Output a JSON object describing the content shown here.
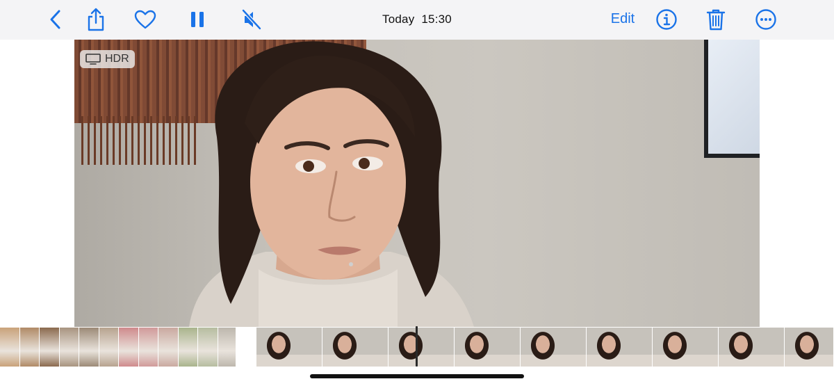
{
  "toolbar": {
    "title_day": "Today",
    "title_time": "15:30",
    "edit_label": "Edit",
    "accent": "#1a73e8",
    "icons": [
      "back-icon",
      "share-icon",
      "heart-icon",
      "pause-icon",
      "muted-speaker-icon",
      "info-icon",
      "trash-icon",
      "more-icon"
    ]
  },
  "video": {
    "badge_label": "HDR",
    "badge_icon": "display-icon"
  },
  "strip": {
    "other_items": [
      {
        "tone": "#c9a27a"
      },
      {
        "tone": "#b08a66"
      },
      {
        "tone": "#8b6a4e"
      },
      {
        "tone": "#a89480"
      },
      {
        "tone": "#9c8a77"
      },
      {
        "tone": "#b7a38f"
      },
      {
        "tone": "#cf8a8c"
      },
      {
        "tone": "#d19a9a"
      },
      {
        "tone": "#caa9a0"
      },
      {
        "tone": "#a9b48c"
      },
      {
        "tone": "#b6bda0"
      },
      {
        "tone": "#bdb7ad"
      }
    ],
    "current_frames": 9,
    "current_tone": "#c6c2bb"
  }
}
